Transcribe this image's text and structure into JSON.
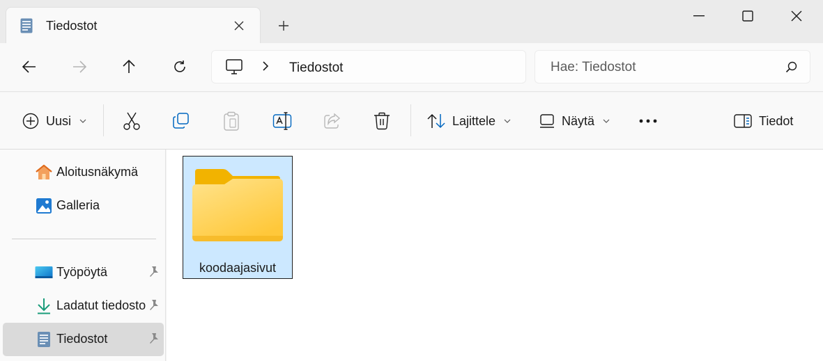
{
  "window": {
    "tab_title": "Tiedostot"
  },
  "address_bar": {
    "breadcrumb": "Tiedostot",
    "search_placeholder": "Hae: Tiedostot"
  },
  "command_bar": {
    "new_label": "Uusi",
    "sort_label": "Lajittele",
    "view_label": "Näytä",
    "details_label": "Tiedot"
  },
  "sidebar": {
    "items": [
      {
        "label": "Aloitusnäkymä",
        "icon": "home-icon"
      },
      {
        "label": "Galleria",
        "icon": "gallery-icon"
      },
      {
        "label": "Työpöytä",
        "icon": "desktop-icon",
        "pinned": true
      },
      {
        "label": "Ladatut tiedosto",
        "icon": "download-icon",
        "pinned": true
      },
      {
        "label": "Tiedostot",
        "icon": "documents-icon",
        "pinned": true,
        "selected": true
      }
    ]
  },
  "content": {
    "items": [
      {
        "name": "koodaajasivut",
        "type": "folder",
        "selected": true
      }
    ]
  },
  "colors": {
    "selection": "#cce8ff",
    "folder_front": "#ffd766",
    "folder_back": "#f5b800",
    "accent": "#0067c0"
  }
}
